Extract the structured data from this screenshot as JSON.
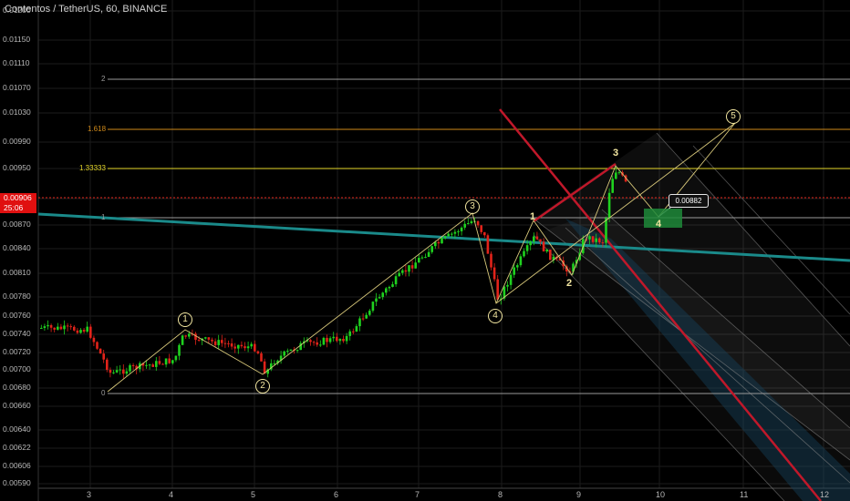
{
  "header": {
    "title": "Contentos / TetherUS, 60, BINANCE"
  },
  "price_scale": [
    "0.01200",
    "0.01150",
    "0.01110",
    "0.01070",
    "0.01030",
    "0.00990",
    "0.00950",
    "0.00906",
    "0.00870",
    "0.00840",
    "0.00810",
    "0.00780",
    "0.00760",
    "0.00740",
    "0.00720",
    "0.00700",
    "0.00680",
    "0.00660",
    "0.00640",
    "0.00622",
    "0.00606",
    "0.00590"
  ],
  "current_price": {
    "value": "0.00906",
    "countdown": "25:06",
    "color": "#e01010"
  },
  "time_scale": [
    "3",
    "4",
    "5",
    "6",
    "7",
    "8",
    "9",
    "10",
    "11",
    "12"
  ],
  "fib_levels": [
    {
      "label": "2",
      "color": "#9a9a9a"
    },
    {
      "label": "1.618",
      "color": "#d08a1a"
    },
    {
      "label": "1.33333",
      "color": "#e6d82a"
    },
    {
      "label": "1",
      "color": "#9a9a9a"
    },
    {
      "label": "0",
      "color": "#9a9a9a"
    }
  ],
  "target_callout": "0.00882",
  "wave_labels": {
    "circled": [
      "1",
      "2",
      "3",
      "4",
      "5"
    ],
    "plain": [
      "1",
      "2",
      "3",
      "4"
    ]
  },
  "colors": {
    "up": "#1fd11f",
    "down": "#e2231a",
    "wave": "#d8c87a",
    "pitchfork": "#c0182a",
    "trend": "#1a8a8a"
  }
}
